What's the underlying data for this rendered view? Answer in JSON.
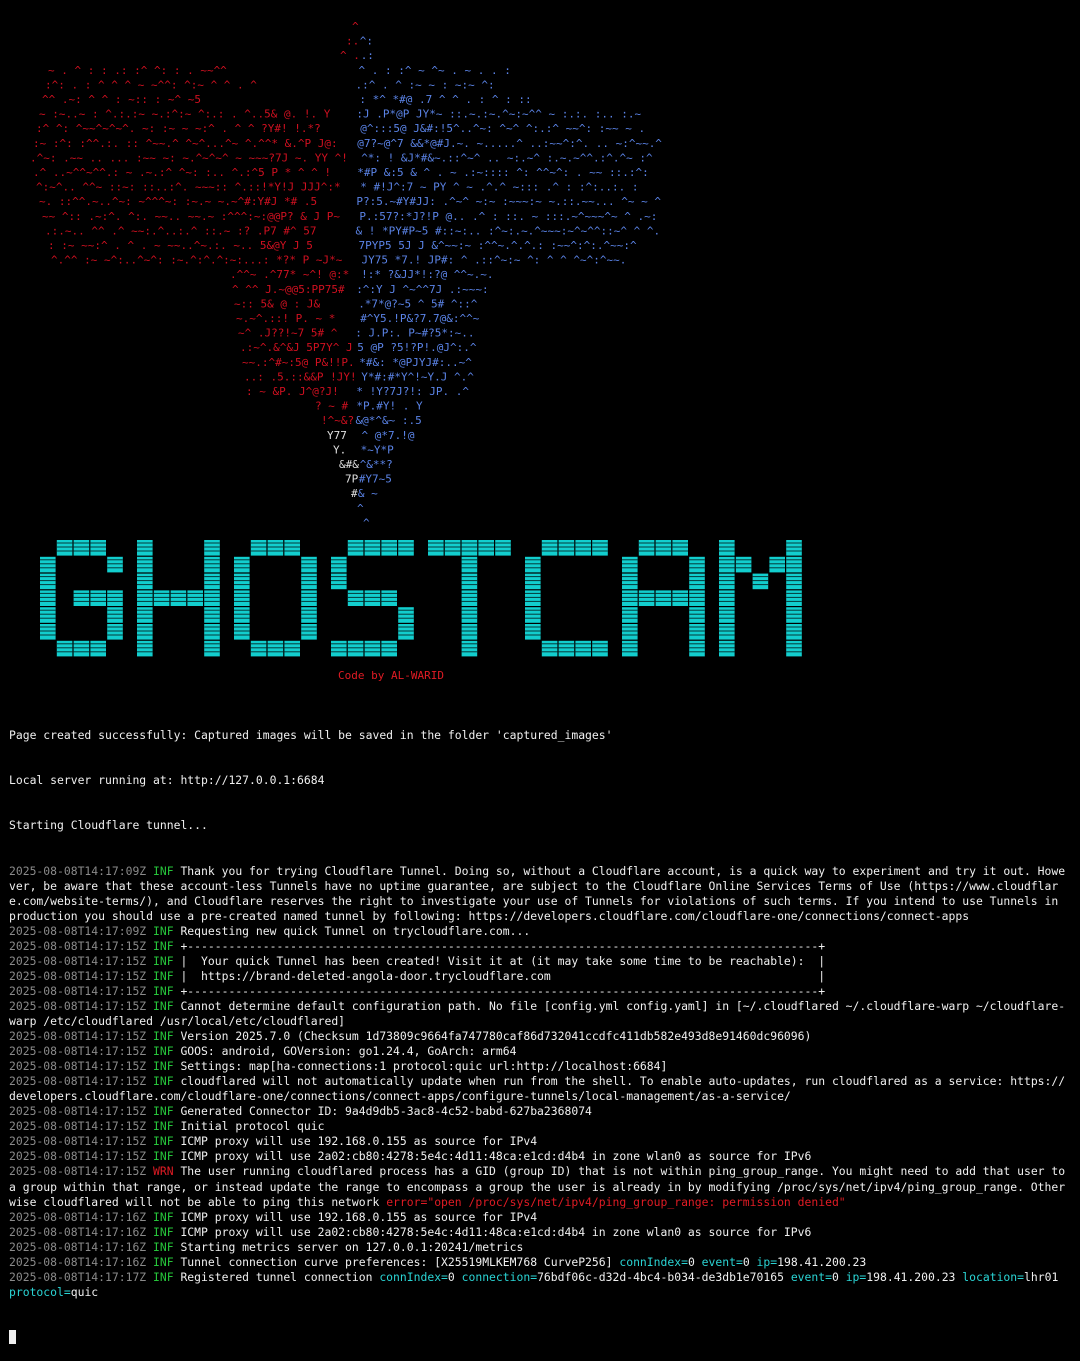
{
  "colors": {
    "background": "#000000",
    "text": "#f0f0f0",
    "timestamp": "#8a8a8a",
    "inf": "#26c53a",
    "wrn": "#e01b24",
    "key": "#2ad4d4",
    "banner": "#14e0e0",
    "art_red": "#d01020",
    "art_blue": "#5b84e8",
    "art_white": "#e0e0e0"
  },
  "ascii_art_icon": "ghost-face-ascii-icon",
  "banner": {
    "letters": [
      "G",
      "H",
      "O",
      "S",
      "T",
      "C",
      "A",
      "M"
    ]
  },
  "credit": "Code by AL-WARID",
  "intro_lines": [
    "Page created successfully: Captured images will be saved in the folder 'captured_images'",
    "Local server running at: http://127.0.0.1:6684",
    "Starting Cloudflare tunnel..."
  ],
  "log": [
    {
      "ts": "2025-08-08T14:17:09Z",
      "level": "INF",
      "parts": [
        {
          "t": "Thank you for trying Cloudflare Tunnel. Doing so, without a Cloudflare account, is a quick way to experiment and try it out. However, be aware that these account-less Tunnels have no uptime guarantee, are subject to the Cloudflare Online Services Terms of Use (https://www.cloudflare.com/website-terms/), and Cloudflare reserves the right to investigate your use of Tunnels for violations of such terms. If you intend to use Tunnels in production you should use a pre-created named tunnel by following: https://developers.cloudflare.com/cloudflare-one/connections/connect-apps"
        }
      ]
    },
    {
      "ts": "2025-08-08T14:17:09Z",
      "level": "INF",
      "parts": [
        {
          "t": "Requesting new quick Tunnel on trycloudflare.com..."
        }
      ]
    },
    {
      "ts": "2025-08-08T14:17:15Z",
      "level": "INF",
      "parts": [
        {
          "t": "+--------------------------------------------------------------------------------------------+"
        }
      ]
    },
    {
      "ts": "2025-08-08T14:17:15Z",
      "level": "INF",
      "parts": [
        {
          "t": "|  Your quick Tunnel has been created! Visit it at (it may take some time to be reachable):  |"
        }
      ]
    },
    {
      "ts": "2025-08-08T14:17:15Z",
      "level": "INF",
      "parts": [
        {
          "t": "|  https://brand-deleted-angola-door.trycloudflare.com                                       |"
        }
      ]
    },
    {
      "ts": "2025-08-08T14:17:15Z",
      "level": "INF",
      "parts": [
        {
          "t": "+--------------------------------------------------------------------------------------------+"
        }
      ]
    },
    {
      "ts": "2025-08-08T14:17:15Z",
      "level": "INF",
      "parts": [
        {
          "t": "Cannot determine default configuration path. No file [config.yml config.yaml] in [~/.cloudflared ~/.cloudflare-warp ~/cloudflare-warp /etc/cloudflared /usr/local/etc/cloudflared]"
        }
      ]
    },
    {
      "ts": "2025-08-08T14:17:15Z",
      "level": "INF",
      "parts": [
        {
          "t": "Version 2025.7.0 (Checksum 1d73809c9664fa747780caf86d732041ccdfc411db582e493d8e91460dc96096)"
        }
      ]
    },
    {
      "ts": "2025-08-08T14:17:15Z",
      "level": "INF",
      "parts": [
        {
          "t": "GOOS: android, GOVersion: go1.24.4, GoArch: arm64"
        }
      ]
    },
    {
      "ts": "2025-08-08T14:17:15Z",
      "level": "INF",
      "parts": [
        {
          "t": "Settings: map[ha-connections:1 protocol:quic url:http://localhost:6684]"
        }
      ]
    },
    {
      "ts": "2025-08-08T14:17:15Z",
      "level": "INF",
      "parts": [
        {
          "t": "cloudflared will not automatically update when run from the shell. To enable auto-updates, run cloudflared as a service: https://developers.cloudflare.com/cloudflare-one/connections/connect-apps/configure-tunnels/local-management/as-a-service/"
        }
      ]
    },
    {
      "ts": "2025-08-08T14:17:15Z",
      "level": "INF",
      "parts": [
        {
          "t": "Generated Connector ID: 9a4d9db5-3ac8-4c52-babd-627ba2368074"
        }
      ]
    },
    {
      "ts": "2025-08-08T14:17:15Z",
      "level": "INF",
      "parts": [
        {
          "t": "Initial protocol quic"
        }
      ]
    },
    {
      "ts": "2025-08-08T14:17:15Z",
      "level": "INF",
      "parts": [
        {
          "t": "ICMP proxy will use 192.168.0.155 as source for IPv4"
        }
      ]
    },
    {
      "ts": "2025-08-08T14:17:15Z",
      "level": "INF",
      "parts": [
        {
          "t": "ICMP proxy will use 2a02:cb80:4278:5e4c:4d11:48ca:e1cd:d4b4 in zone wlan0 as source for IPv6"
        }
      ]
    },
    {
      "ts": "2025-08-08T14:17:15Z",
      "level": "WRN",
      "parts": [
        {
          "t": "The user running cloudflared process has a GID (group ID) that is not within ping_group_range. You might need to add that user to a group within that range, or instead update the range to encompass a group the user is already in by modifying /proc/sys/net/ipv4/ping_group_range. Otherwise cloudflared will not be able to ping this network "
        },
        {
          "t": "error=\"open /proc/sys/net/ipv4/ping_group_range: permission denied\"",
          "c": "err"
        }
      ]
    },
    {
      "ts": "2025-08-08T14:17:16Z",
      "level": "INF",
      "parts": [
        {
          "t": "ICMP proxy will use 192.168.0.155 as source for IPv4"
        }
      ]
    },
    {
      "ts": "2025-08-08T14:17:16Z",
      "level": "INF",
      "parts": [
        {
          "t": "ICMP proxy will use 2a02:cb80:4278:5e4c:4d11:48ca:e1cd:d4b4 in zone wlan0 as source for IPv6"
        }
      ]
    },
    {
      "ts": "2025-08-08T14:17:16Z",
      "level": "INF",
      "parts": [
        {
          "t": "Starting metrics server on 127.0.0.1:20241/metrics"
        }
      ]
    },
    {
      "ts": "2025-08-08T14:17:16Z",
      "level": "INF",
      "parts": [
        {
          "t": "Tunnel connection curve preferences: [X25519MLKEM768 CurveP256] "
        },
        {
          "t": "connIndex=",
          "c": "key"
        },
        {
          "t": "0 "
        },
        {
          "t": "event=",
          "c": "key"
        },
        {
          "t": "0 "
        },
        {
          "t": "ip=",
          "c": "key"
        },
        {
          "t": "198.41.200.23"
        }
      ]
    },
    {
      "ts": "2025-08-08T14:17:17Z",
      "level": "INF",
      "parts": [
        {
          "t": "Registered tunnel connection "
        },
        {
          "t": "connIndex=",
          "c": "key"
        },
        {
          "t": "0 "
        },
        {
          "t": "connection=",
          "c": "key"
        },
        {
          "t": "76bdf06c-d32d-4bc4-b034-de3db1e70165 "
        },
        {
          "t": "event=",
          "c": "key"
        },
        {
          "t": "0 "
        },
        {
          "t": "ip=",
          "c": "key"
        },
        {
          "t": "198.41.200.23 "
        },
        {
          "t": "location=",
          "c": "key"
        },
        {
          "t": "lhr01 "
        },
        {
          "t": "protocol=",
          "c": "key"
        },
        {
          "t": "quic"
        }
      ]
    }
  ]
}
